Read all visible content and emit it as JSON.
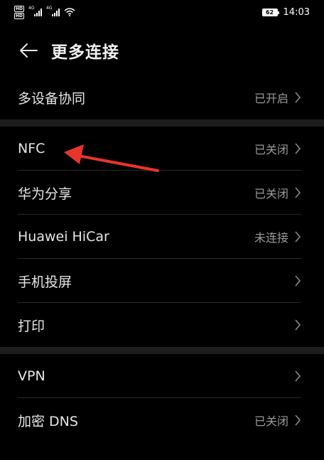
{
  "status_bar": {
    "hd1": "HD",
    "hd2": "HD",
    "net1": "4G",
    "net2": "4G",
    "battery": "62",
    "time": "14:03"
  },
  "header": {
    "title": "更多连接",
    "back_icon": "arrow-left-icon"
  },
  "groups": [
    {
      "items": [
        {
          "label": "多设备协同",
          "status": "已开启"
        }
      ]
    },
    {
      "items": [
        {
          "label": "NFC",
          "status": "已关闭"
        },
        {
          "label": "华为分享",
          "status": "已关闭"
        },
        {
          "label": "Huawei HiCar",
          "status": "未连接"
        },
        {
          "label": "手机投屏",
          "status": ""
        },
        {
          "label": "打印",
          "status": ""
        }
      ]
    },
    {
      "items": [
        {
          "label": "VPN",
          "status": ""
        },
        {
          "label": "加密 DNS",
          "status": "已关闭"
        }
      ]
    }
  ],
  "colors": {
    "background": "#000000",
    "section_band": "#1d1d1d",
    "annotation_arrow": "#e8352b"
  }
}
